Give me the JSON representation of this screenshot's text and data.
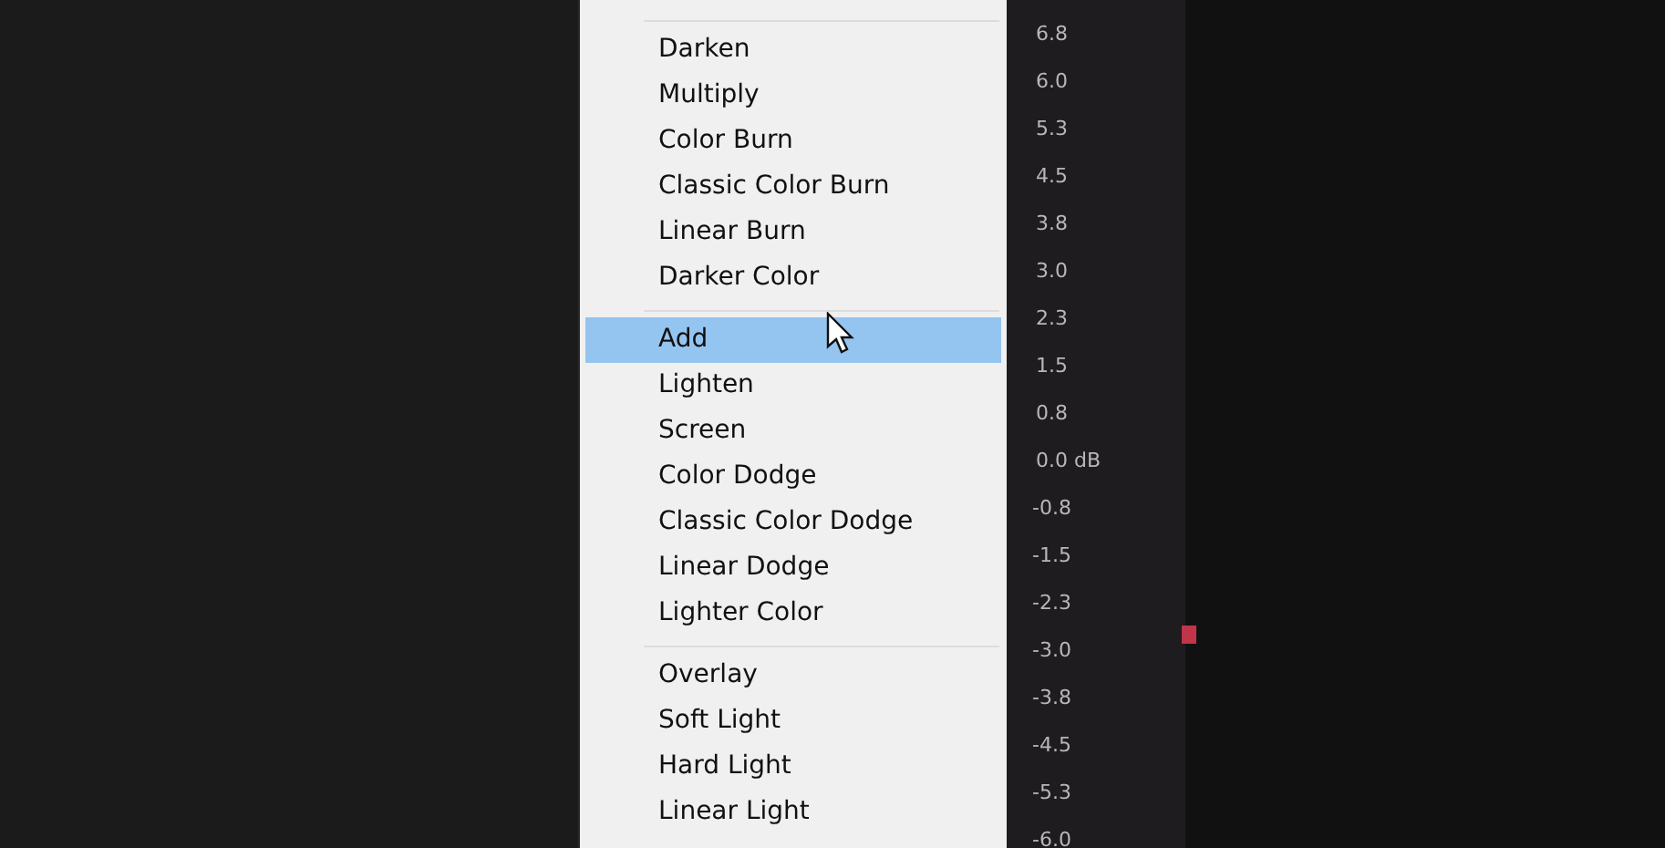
{
  "blend_menu": {
    "groups": [
      {
        "items": [
          {
            "label": "Darken",
            "selected": false
          },
          {
            "label": "Multiply",
            "selected": false
          },
          {
            "label": "Color Burn",
            "selected": false
          },
          {
            "label": "Classic Color Burn",
            "selected": false
          },
          {
            "label": "Linear Burn",
            "selected": false
          },
          {
            "label": "Darker Color",
            "selected": false
          }
        ]
      },
      {
        "items": [
          {
            "label": "Add",
            "selected": true
          },
          {
            "label": "Lighten",
            "selected": false
          },
          {
            "label": "Screen",
            "selected": false
          },
          {
            "label": "Color Dodge",
            "selected": false
          },
          {
            "label": "Classic Color Dodge",
            "selected": false
          },
          {
            "label": "Linear Dodge",
            "selected": false
          },
          {
            "label": "Lighter Color",
            "selected": false
          }
        ]
      },
      {
        "items": [
          {
            "label": "Overlay",
            "selected": false
          },
          {
            "label": "Soft Light",
            "selected": false
          },
          {
            "label": "Hard Light",
            "selected": false
          },
          {
            "label": "Linear Light",
            "selected": false
          }
        ]
      }
    ]
  },
  "meter_scale": {
    "labels": [
      "6.8",
      "6.0",
      "5.3",
      "4.5",
      "3.8",
      "3.0",
      "2.3",
      "1.5",
      "0.8",
      "0.0 dB",
      "-0.8",
      "-1.5",
      "-2.3",
      "-3.0",
      "-3.8",
      "-4.5",
      "-5.3",
      "-6.0"
    ]
  }
}
